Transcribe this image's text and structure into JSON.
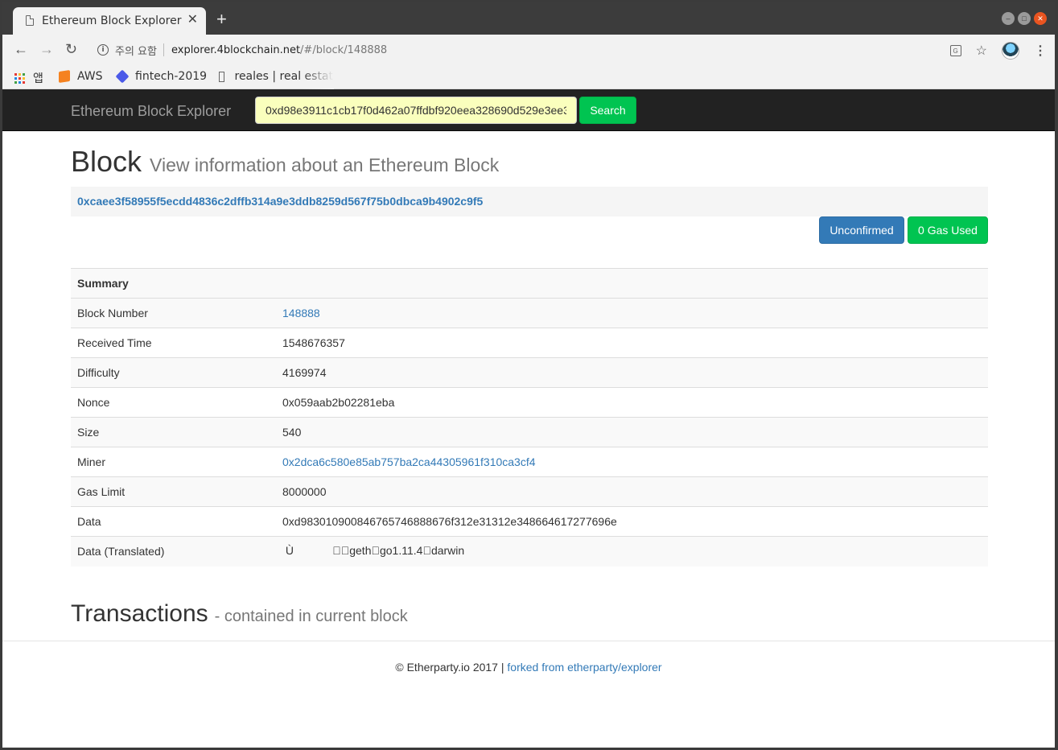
{
  "browser": {
    "tab_title": "Ethereum Block Explorer",
    "tab_close": "✕",
    "new_tab": "+",
    "security_warning": "주의 요함",
    "url_host": "explorer.4blockchain.net",
    "url_path": "/#/block/148888",
    "bookmarks": {
      "apps": "앱",
      "aws": "AWS",
      "fintech": "fintech-2019",
      "reales": "reales | real estat"
    }
  },
  "navbar": {
    "brand": "Ethereum Block Explorer",
    "search_value": "0xd98e3911c1cb17f0d462a07ffdbf920eea328690d529e3ee3",
    "search_button": "Search"
  },
  "header": {
    "title": "Block",
    "subtitle": "View information about an Ethereum Block"
  },
  "block_hash": "0xcaee3f58955f5ecdd4836c2dffb314a9e3ddb8259d567f75b0dbca9b4902c9f5",
  "badges": {
    "status": "Unconfirmed",
    "gas": "0 Gas Used"
  },
  "summary": {
    "heading": "Summary",
    "rows": [
      {
        "label": "Block Number",
        "value": "148888"
      },
      {
        "label": "Received Time",
        "value": "1548676357"
      },
      {
        "label": "Difficulty",
        "value": "4169974"
      },
      {
        "label": "Nonce",
        "value": "0x059aab2b02281eba"
      },
      {
        "label": "Size",
        "value": "540"
      },
      {
        "label": "Miner",
        "value": "0x2dca6c580e85ab757ba2ca44305961f310ca3cf4"
      },
      {
        "label": "Gas Limit",
        "value": "8000000"
      },
      {
        "label": "Data",
        "value": "0xd983010900846765746888676f312e31312e348664617277696e"
      },
      {
        "label": "Data (Translated)",
        "value": " Ù\u0001\t\u0000gethgo1.11.4darwin"
      }
    ]
  },
  "transactions": {
    "title": "Transactions",
    "subtitle": "- contained in current block"
  },
  "footer": {
    "copyright": "© Etherparty.io 2017 |",
    "link": "forked from etherparty/explorer"
  }
}
